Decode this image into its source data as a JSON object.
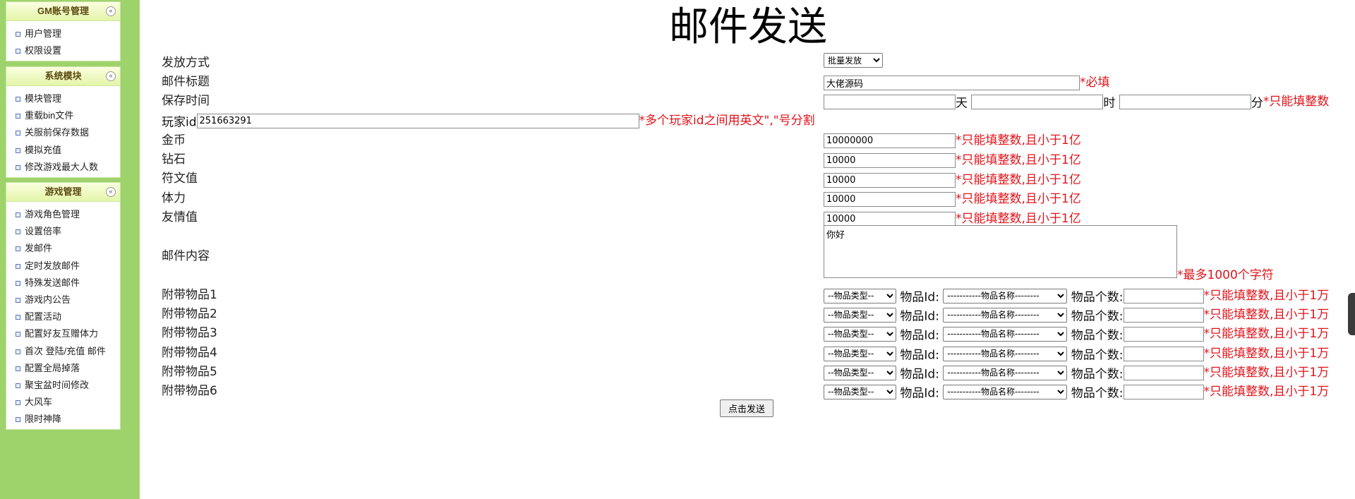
{
  "sidebar": {
    "sections": [
      {
        "title": "GM账号管理",
        "items": [
          "用户管理",
          "权限设置"
        ]
      },
      {
        "title": "系统模块",
        "items": [
          "模块管理",
          "重载bin文件",
          "关服前保存数据",
          "模拟充值",
          "修改游戏最大人数"
        ]
      },
      {
        "title": "游戏管理",
        "items": [
          "游戏角色管理",
          "设置倍率",
          "发邮件",
          "定时发放邮件",
          "特殊发送邮件",
          "游戏内公告",
          "配置活动",
          "配置好友互赠体力",
          "首次 登陆/充值 邮件",
          "配置全局掉落",
          "聚宝盆时间修改",
          "大风车",
          "限时神降"
        ]
      }
    ],
    "collapse_glyph": "«"
  },
  "page_title": "邮件发送",
  "form": {
    "send_mode": {
      "label": "发放方式",
      "selected": "批量发放"
    },
    "mail_title": {
      "label": "邮件标题",
      "value": "大佬源码",
      "hint": "*必填"
    },
    "save_time": {
      "label": "保存时间",
      "unit_day": "天",
      "unit_hour": "时",
      "unit_min": "分",
      "hint": "*只能填整数"
    },
    "player_id": {
      "label": "玩家id",
      "value": "251663291",
      "hint": "*多个玩家id之间用英文\",\"号分割"
    },
    "gold": {
      "label": "金币",
      "value": "10000000",
      "hint": "*只能填整数,且小于1亿"
    },
    "diamond": {
      "label": "钻石",
      "value": "10000",
      "hint": "*只能填整数,且小于1亿"
    },
    "rune": {
      "label": "符文值",
      "value": "10000",
      "hint": "*只能填整数,且小于1亿"
    },
    "stamina": {
      "label": "体力",
      "value": "10000",
      "hint": "*只能填整数,且小于1亿"
    },
    "friendship": {
      "label": "友情值",
      "value": "10000",
      "hint": "*只能填整数,且小于1亿"
    },
    "content": {
      "label": "邮件内容",
      "value": "你好",
      "hint": "*最多1000个字符"
    },
    "attachments": [
      {
        "label": "附带物品1"
      },
      {
        "label": "附带物品2"
      },
      {
        "label": "附带物品3"
      },
      {
        "label": "附带物品4"
      },
      {
        "label": "附带物品5"
      },
      {
        "label": "附带物品6"
      }
    ],
    "attach_type_placeholder": "--物品类型--",
    "attach_id_label": "物品Id:",
    "attach_name_placeholder": "-----------物品名称--------",
    "attach_count_label": "物品个数:",
    "attach_hint": "*只能填整数,且小于1万",
    "submit": "点击发送"
  }
}
